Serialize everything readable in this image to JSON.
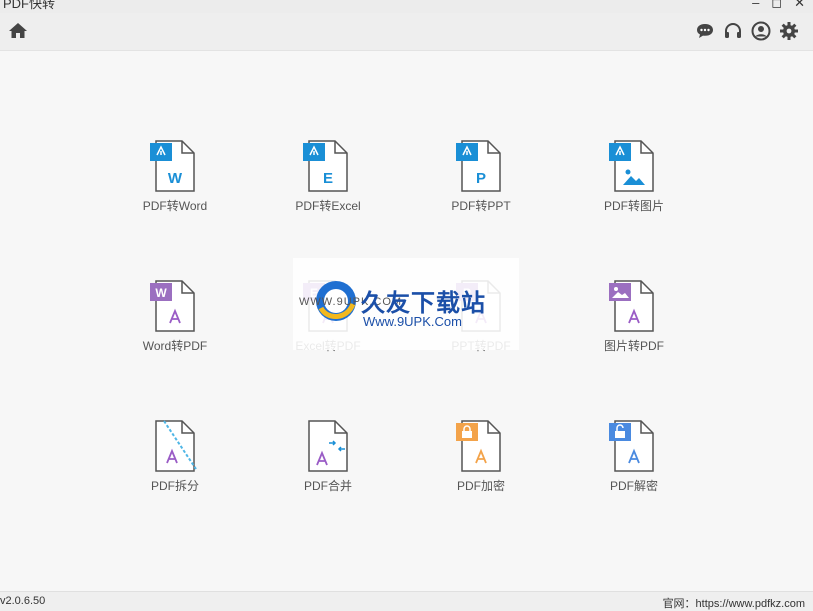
{
  "window": {
    "title": "PDF快转",
    "minimize": "–",
    "maximize": "◻",
    "close": "✕"
  },
  "toolbar": {
    "home_icon": "home-icon",
    "icons": [
      "chat-icon",
      "headset-icon",
      "user-icon",
      "gear-icon"
    ]
  },
  "tiles": [
    {
      "label": "PDF转Word",
      "letter": "W"
    },
    {
      "label": "PDF转Excel",
      "letter": "E"
    },
    {
      "label": "PDF转PPT",
      "letter": "P"
    },
    {
      "label": "PDF转图片",
      "letter": ""
    },
    {
      "label": "Word转PDF",
      "letter": "W"
    },
    {
      "label": "Excel转PDF",
      "letter": "E"
    },
    {
      "label": "PPT转PDF",
      "letter": "P"
    },
    {
      "label": "图片转PDF",
      "letter": ""
    },
    {
      "label": "PDF拆分",
      "letter": ""
    },
    {
      "label": "PDF合并",
      "letter": ""
    },
    {
      "label": "PDF加密",
      "letter": ""
    },
    {
      "label": "PDF解密",
      "letter": ""
    }
  ],
  "watermark": {
    "brand": "久友下载站",
    "url": "Www.9UPK.Com",
    "small": "WWW.9UPK.COM"
  },
  "footer": {
    "version": "v2.0.6.50",
    "site": "官网：https://www.pdfkz.com"
  },
  "colors": {
    "pdf_blue": "#1a8fd6",
    "word_purple": "#9b6fc0",
    "lock_orange": "#f3a34a",
    "unlock_blue": "#4a8ae0",
    "acrobat_purple": "#9a5cc6"
  }
}
